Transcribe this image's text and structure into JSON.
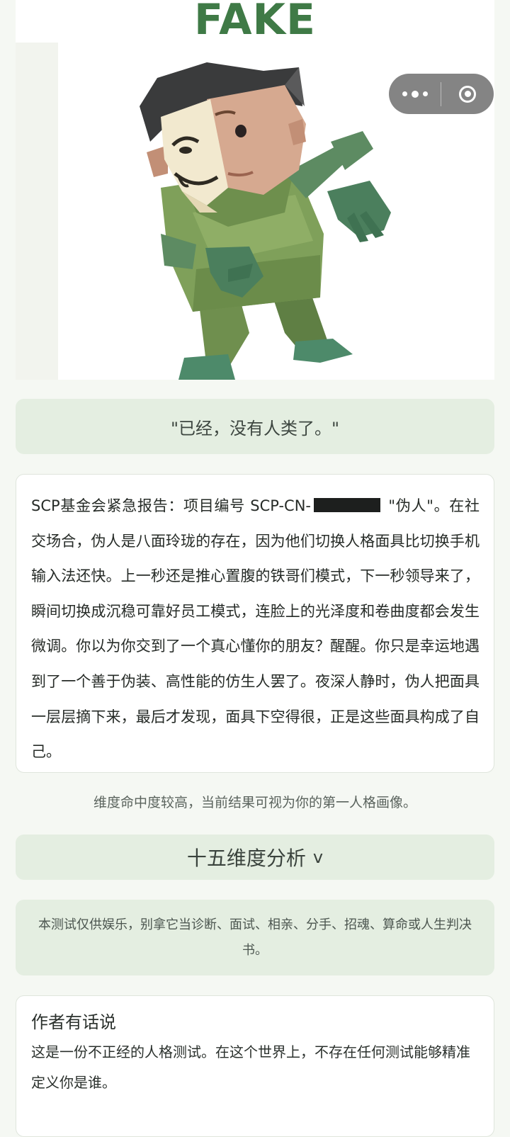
{
  "hero": {
    "banner_text": "FAKE"
  },
  "capsule": {
    "more_icon": "more-dots-icon",
    "close_icon": "target-close-icon"
  },
  "quote": "\"已经，没有人类了。\"",
  "report": {
    "prefix": "SCP基金会紧急报告：项目编号 SCP-CN-",
    "suffix": " \"伪人\"。",
    "body": "在社交场合，伪人是八面玲珑的存在，因为他们切换人格面具比切换手机输入法还快。上一秒还是推心置腹的铁哥们模式，下一秒领导来了，瞬间切换成沉稳可靠好员工模式，连脸上的光泽度和卷曲度都会发生微调。你以为你交到了一个真心懂你的朋友？醒醒。你只是幸运地遇到了一个善于伪装、高性能的仿生人罢了。夜深人静时，伪人把面具一层层摘下来，最后才发现，面具下空得很，正是这些面具构成了自己。"
  },
  "dimension_note": "维度命中度较高，当前结果可视为你的第一人格画像。",
  "analysis": {
    "label": "十五维度分析",
    "chevron": "v"
  },
  "disclaimer": "本测试仅供娱乐，别拿它当诊断、面试、相亲、分手、招魂、算命或人生判决书。",
  "author": {
    "title": "作者有话说",
    "text": "这是一份不正经的人格测试。在这个世界上，不存在任何测试能够精准定义你是谁。"
  },
  "colors": {
    "accent_green": "#3f7a46",
    "panel_green": "#e4eee1",
    "page_bg": "#f5f8f3"
  }
}
